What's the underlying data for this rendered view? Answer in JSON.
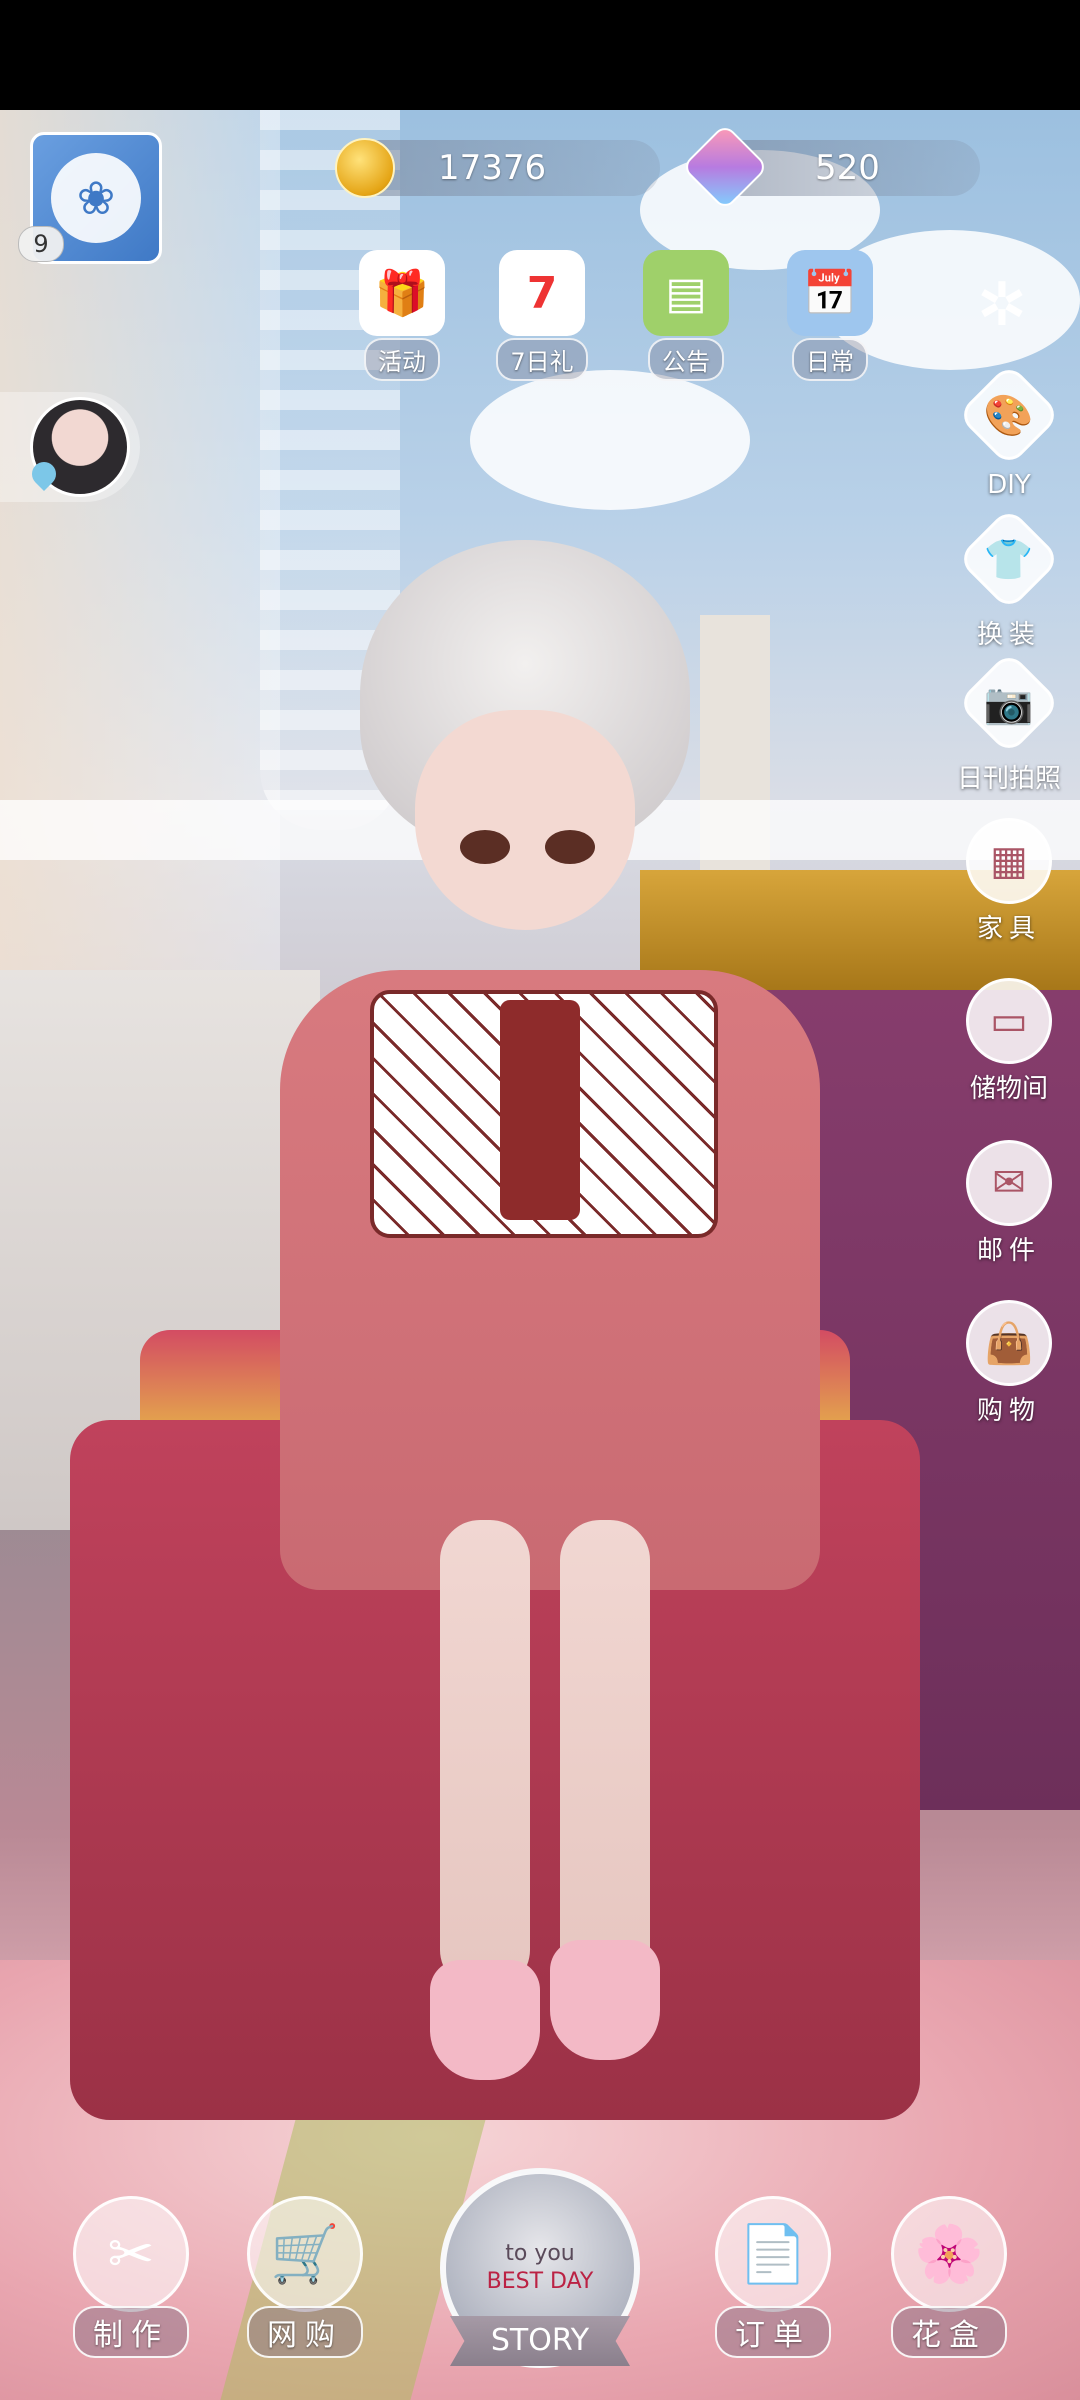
{
  "resources": {
    "coins": "17376",
    "gems": "520"
  },
  "player": {
    "level": "9"
  },
  "top_menu": [
    {
      "label": "活动",
      "icon": "🎁",
      "bg": "#ffffff"
    },
    {
      "label": "7日礼",
      "icon": "7",
      "bg": "#ffffff"
    },
    {
      "label": "公告",
      "icon": "▤",
      "bg": "#9fd06a"
    },
    {
      "label": "日常",
      "icon": "📅",
      "bg": "#9ec6ee"
    }
  ],
  "side_menu": [
    {
      "label": "DIY",
      "icon": "🎨"
    },
    {
      "label": "换装",
      "icon": "👕"
    },
    {
      "label": "日刊拍照",
      "icon": "📷"
    },
    {
      "label": "家具",
      "icon": "▦"
    },
    {
      "label": "储物间",
      "icon": "▭"
    },
    {
      "label": "邮件",
      "icon": "✉"
    },
    {
      "label": "购物",
      "icon": "👜"
    }
  ],
  "bottom_menu": [
    {
      "label": "制作",
      "icon": "✂"
    },
    {
      "label": "网购",
      "icon": "🛒"
    },
    {
      "label": "订单",
      "icon": "📄"
    },
    {
      "label": "花盒",
      "icon": "🌸"
    }
  ],
  "story": {
    "label": "STORY",
    "sign_lines": [
      "to you",
      "BEST DAY"
    ]
  },
  "colors": {
    "accent_blue": "#3f79c6",
    "dress_pink": "#d87a7f",
    "ottoman_red": "#c0425c",
    "gold": "#d7a53b"
  }
}
